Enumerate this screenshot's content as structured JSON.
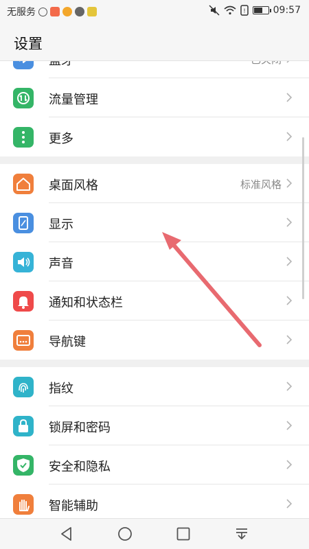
{
  "status_bar": {
    "carrier": "无服务",
    "time": "09:57",
    "battery_level": 0.6
  },
  "header": {
    "title": "设置"
  },
  "groups": [
    [
      {
        "label": "蓝牙",
        "value": "已关闭",
        "icon": "bluetooth-icon",
        "color": "#4a8fe0"
      },
      {
        "label": "流量管理",
        "value": "",
        "icon": "data-traffic-icon",
        "color": "#34b567"
      },
      {
        "label": "更多",
        "value": "",
        "icon": "more-icon",
        "color": "#34b567"
      }
    ],
    [
      {
        "label": "桌面风格",
        "value": "标准风格",
        "icon": "home-style-icon",
        "color": "#f07f3c"
      },
      {
        "label": "显示",
        "value": "",
        "icon": "display-icon",
        "color": "#4a8fe0"
      },
      {
        "label": "声音",
        "value": "",
        "icon": "sound-icon",
        "color": "#36b3d7"
      },
      {
        "label": "通知和状态栏",
        "value": "",
        "icon": "notification-icon",
        "color": "#ef4a4a"
      },
      {
        "label": "导航键",
        "value": "",
        "icon": "navigation-key-icon",
        "color": "#f07f3c"
      }
    ],
    [
      {
        "label": "指纹",
        "value": "",
        "icon": "fingerprint-icon",
        "color": "#2fb3c9"
      },
      {
        "label": "锁屏和密码",
        "value": "",
        "icon": "lock-icon",
        "color": "#2fb3c9"
      },
      {
        "label": "安全和隐私",
        "value": "",
        "icon": "shield-icon",
        "color": "#34b567"
      },
      {
        "label": "智能辅助",
        "value": "",
        "icon": "hand-icon",
        "color": "#f07f3c"
      }
    ]
  ],
  "colors": {
    "arrow": "#e86a70",
    "background": "#f6f6f6"
  }
}
